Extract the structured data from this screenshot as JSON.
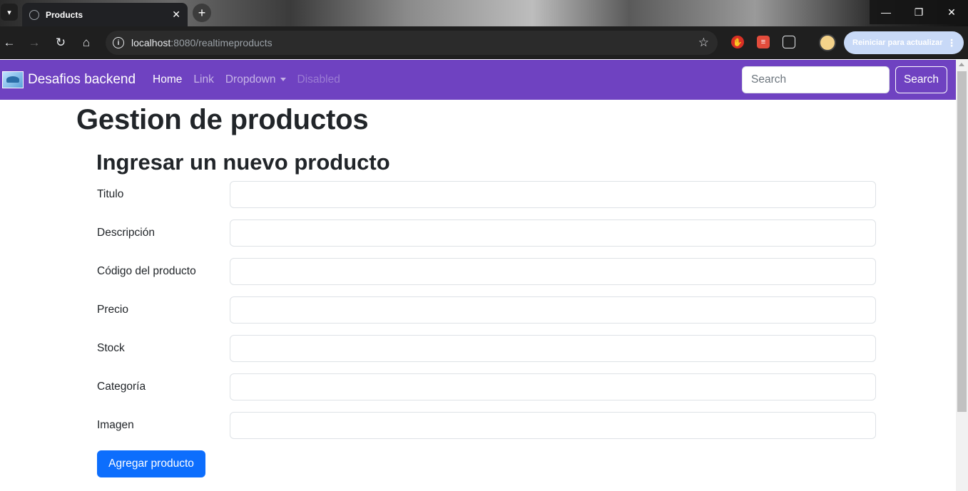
{
  "browser": {
    "tab_title": "Products",
    "tab_close": "✕",
    "new_tab": "+",
    "url_host": "localhost",
    "url_path": ":8080/realtimeproducts",
    "update_button": "Reiniciar para actualizar",
    "window_controls": {
      "minimize": "—",
      "restore": "❐",
      "close": "✕"
    }
  },
  "navbar": {
    "brand": "Desafios backend",
    "links": [
      {
        "label": "Home",
        "state": "active"
      },
      {
        "label": "Link",
        "state": "normal"
      },
      {
        "label": "Dropdown",
        "state": "dropdown"
      },
      {
        "label": "Disabled",
        "state": "disabled"
      }
    ],
    "search_placeholder": "Search",
    "search_button": "Search",
    "color": "#6f42c1"
  },
  "main": {
    "title": "Gestion de productos",
    "form": {
      "heading": "Ingresar un nuevo producto",
      "fields": [
        {
          "label": "Titulo",
          "value": ""
        },
        {
          "label": "Descripción",
          "value": ""
        },
        {
          "label": "Código del producto",
          "value": ""
        },
        {
          "label": "Precio",
          "value": ""
        },
        {
          "label": "Stock",
          "value": ""
        },
        {
          "label": "Categoría",
          "value": ""
        },
        {
          "label": "Imagen",
          "value": ""
        }
      ],
      "submit_label": "Agregar producto",
      "submit_color": "#0d6efd"
    }
  }
}
